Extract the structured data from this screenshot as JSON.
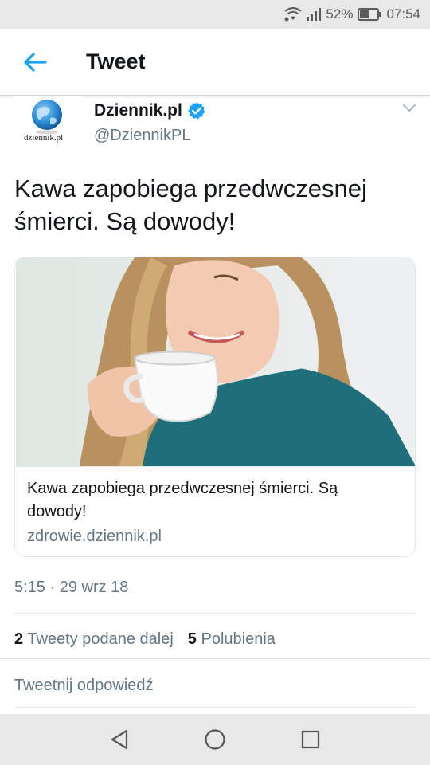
{
  "status_bar": {
    "battery": "52%",
    "time": "07:54",
    "icons": [
      "wifi-icon",
      "signal-icon",
      "battery-icon"
    ]
  },
  "header": {
    "title": "Tweet",
    "back_icon": "arrow-left-icon"
  },
  "tweet": {
    "avatar_text": "dziennik.pl",
    "display_name": "Dziennik.pl",
    "handle": "@DziennikPL",
    "verified": true,
    "text": "Kawa zapobiega przedwczesnej śmierci. Są dowody!",
    "card": {
      "title": "Kawa zapobiega przedwczesnej śmierci. Są dowody!",
      "domain": "zdrowie.dziennik.pl"
    },
    "timestamp": "5:15 · 29 wrz 18",
    "retweets": {
      "count": "2",
      "label": "Tweety podane dalej"
    },
    "likes": {
      "count": "5",
      "label": "Polubienia"
    },
    "reply_placeholder": "Tweetnij odpowiedź"
  },
  "nav_bar": {
    "icons": [
      "back-triangle-icon",
      "home-circle-icon",
      "recents-square-icon"
    ]
  },
  "colors": {
    "accent": "#1da1f2",
    "text_primary": "#14171a",
    "text_secondary": "#657786",
    "border": "#e1e8ed",
    "system_bar": "#e8e8e8"
  }
}
